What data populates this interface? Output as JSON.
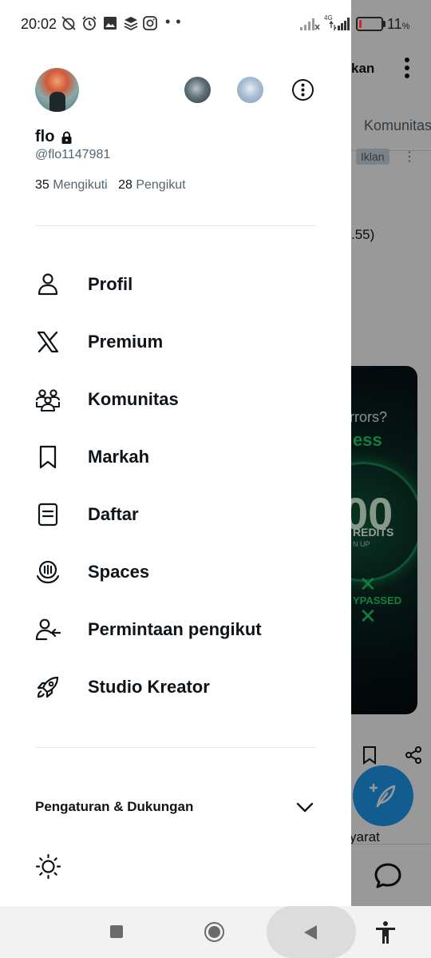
{
  "status_bar": {
    "time": "20:02",
    "network": "4G",
    "battery_percent": "11",
    "battery_unit": "%",
    "battery_level": 0.11,
    "battery_color": "#e02020",
    "icons": [
      "alarm-off-icon",
      "alarm-icon",
      "gallery-icon",
      "layers-icon",
      "instagram-icon",
      "more-dots-icon",
      "signal-icon",
      "signal-4g-icon",
      "battery-icon"
    ]
  },
  "profile": {
    "display_name": "flo",
    "handle": "@flo1147981",
    "following_count": "35",
    "following_label": "Mengikuti",
    "followers_count": "28",
    "followers_label": "Pengikut"
  },
  "menu": {
    "items": [
      {
        "label": "Profil",
        "icon": "person-icon"
      },
      {
        "label": "Premium",
        "icon": "x-logo-icon"
      },
      {
        "label": "Komunitas",
        "icon": "communities-icon"
      },
      {
        "label": "Markah",
        "icon": "bookmark-icon"
      },
      {
        "label": "Daftar",
        "icon": "list-icon"
      },
      {
        "label": "Spaces",
        "icon": "spaces-icon"
      },
      {
        "label": "Permintaan pengikut",
        "icon": "follow-request-icon"
      },
      {
        "label": "Studio Kreator",
        "icon": "rocket-icon"
      }
    ]
  },
  "settings": {
    "label": "Pengaturan & Dukungan"
  },
  "background": {
    "header_title": "kan",
    "tab_label": "Komunitas",
    "ad_badge": "Iklan",
    "ad_more": "⋮",
    "text_fragment": ".55)",
    "card_lines": [
      "rrors?",
      "ess",
      "00",
      "REDITS",
      "N UP",
      "YPASSED"
    ],
    "bottom_text": "yarat",
    "accent_color": "#1d9bf0"
  },
  "colors": {
    "text_primary": "#0f1419",
    "text_secondary": "#536471"
  }
}
